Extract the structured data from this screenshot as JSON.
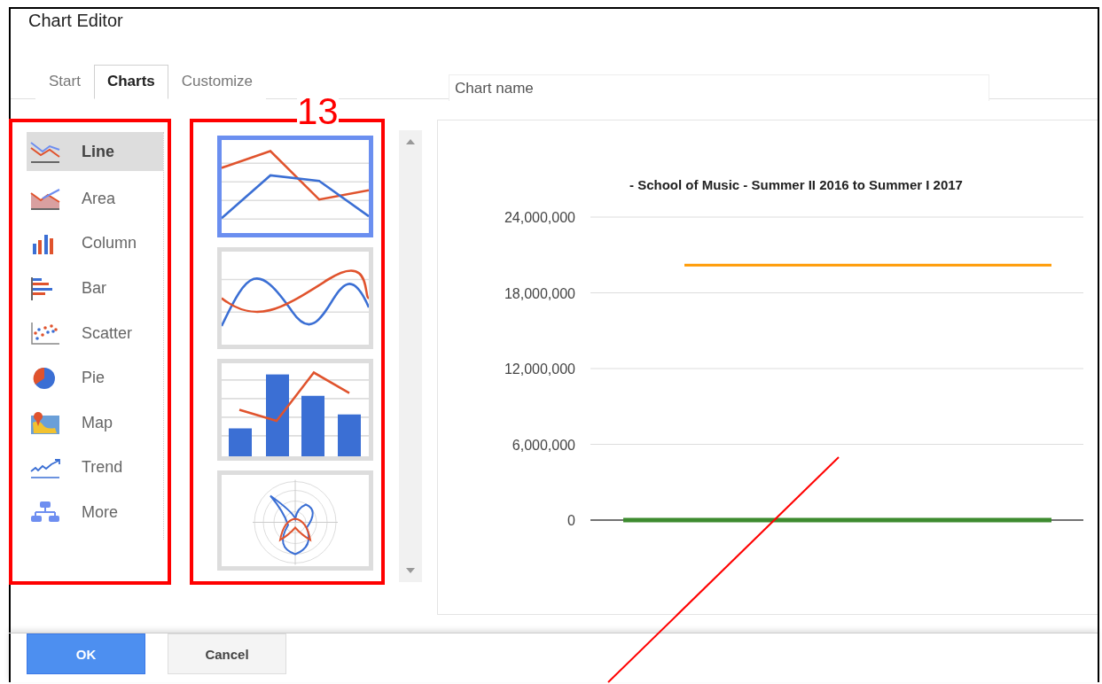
{
  "window": {
    "title": "Chart Editor"
  },
  "tabs": [
    {
      "label": "Start",
      "selected": false
    },
    {
      "label": "Charts",
      "selected": true
    },
    {
      "label": "Customize",
      "selected": false
    }
  ],
  "chart_name": {
    "placeholder": "Chart name"
  },
  "annotation": {
    "label": "13"
  },
  "chart_types": [
    {
      "kind": "line",
      "label": "Line",
      "selected": true
    },
    {
      "kind": "area",
      "label": "Area",
      "selected": false
    },
    {
      "kind": "column",
      "label": "Column",
      "selected": false
    },
    {
      "kind": "bar",
      "label": "Bar",
      "selected": false
    },
    {
      "kind": "scatter",
      "label": "Scatter",
      "selected": false
    },
    {
      "kind": "pie",
      "label": "Pie",
      "selected": false
    },
    {
      "kind": "map",
      "label": "Map",
      "selected": false
    },
    {
      "kind": "trend",
      "label": "Trend",
      "selected": false
    },
    {
      "kind": "more",
      "label": "More",
      "selected": false
    }
  ],
  "thumbnails": [
    {
      "kind": "line",
      "selected": true
    },
    {
      "kind": "curve",
      "selected": false
    },
    {
      "kind": "combo",
      "selected": false
    },
    {
      "kind": "radar",
      "selected": false
    }
  ],
  "preview": {
    "chart_data": {
      "type": "line",
      "grid": true,
      "title": "- School of Music - Summer II 2016 to Summer I 2017",
      "ylim": [
        0,
        24000000
      ],
      "yticks": [
        {
          "value": 0,
          "label": "0"
        },
        {
          "value": 6000000,
          "label": "6,000,000"
        },
        {
          "value": 12000000,
          "label": "12,000,000"
        },
        {
          "value": 18000000,
          "label": "18,000,000"
        },
        {
          "value": 24000000,
          "label": "24,000,000"
        }
      ],
      "series": [
        {
          "color": "#ff9900",
          "values": [
            null,
            20200000,
            20200000,
            20200000,
            20200000,
            20200000,
            20200000,
            20200000
          ]
        },
        {
          "color": "#3d8b2f",
          "values": [
            0,
            0,
            0,
            0,
            0,
            0,
            0,
            0
          ]
        }
      ]
    }
  },
  "buttons": [
    {
      "kind": "primary",
      "label": "OK"
    },
    {
      "kind": "secondary",
      "label": "Cancel"
    }
  ]
}
